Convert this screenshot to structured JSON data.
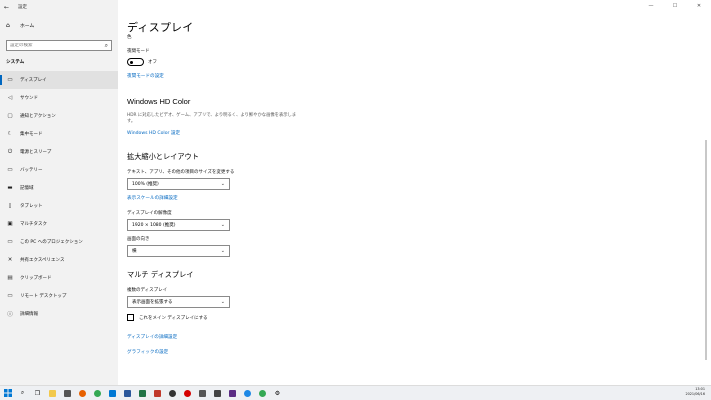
{
  "window": {
    "title": "設定",
    "back_icon": "←",
    "controls": {
      "minimize": "—",
      "maximize": "☐",
      "close": "✕"
    }
  },
  "sidebar": {
    "home_label": "ホーム",
    "search_placeholder": "設定の検索",
    "section_title": "システム",
    "items": [
      {
        "label": "ディスプレイ",
        "icon": "monitor-icon",
        "active": true
      },
      {
        "label": "サウンド",
        "icon": "speaker-icon"
      },
      {
        "label": "通知とアクション",
        "icon": "notification-icon"
      },
      {
        "label": "集中モード",
        "icon": "moon-icon"
      },
      {
        "label": "電源とスリープ",
        "icon": "power-icon"
      },
      {
        "label": "バッテリー",
        "icon": "battery-icon"
      },
      {
        "label": "記憶域",
        "icon": "storage-icon"
      },
      {
        "label": "タブレット",
        "icon": "tablet-icon"
      },
      {
        "label": "マルチタスク",
        "icon": "multitask-icon"
      },
      {
        "label": "この PC へのプロジェクション",
        "icon": "projection-icon"
      },
      {
        "label": "共有エクスペリエンス",
        "icon": "share-icon"
      },
      {
        "label": "クリップボード",
        "icon": "clipboard-icon"
      },
      {
        "label": "リモート デスクトップ",
        "icon": "remote-desktop-icon"
      },
      {
        "label": "詳細情報",
        "icon": "info-icon"
      }
    ]
  },
  "main": {
    "title": "ディスプレイ",
    "color_section": "色",
    "night_light": {
      "label": "夜間モード",
      "state": "オフ",
      "settings_link": "夜間モードの設定"
    },
    "hdr": {
      "heading": "Windows HD Color",
      "description": "HDR に対応したビデオ、ゲーム、アプリで、より明るく、より鮮やかな画像を表示します。",
      "link": "Windows HD Color 設定"
    },
    "scale_layout": {
      "heading": "拡大縮小とレイアウト",
      "scale_label": "テキスト、アプリ、その他の項目のサイズを変更する",
      "scale_value": "100% (推奨)",
      "advanced_scaling_link": "表示スケールの詳細設定",
      "resolution_label": "ディスプレイの解像度",
      "resolution_value": "1920 × 1080 (推奨)",
      "orientation_label": "画面の向き",
      "orientation_value": "横"
    },
    "multi_display": {
      "heading": "マルチ ディスプレイ",
      "label": "複数のディスプレイ",
      "value": "表示画面を拡張する",
      "main_display_checkbox": "これをメイン ディスプレイにする",
      "advanced_display_link": "ディスプレイの詳細設定",
      "graphics_link": "グラフィックの設定"
    }
  },
  "taskbar": {
    "time": "13:01",
    "date": "2021/06/16",
    "apps": [
      {
        "name": "start-icon",
        "color": "#0078d4"
      },
      {
        "name": "search-icon",
        "color": "#222222"
      },
      {
        "name": "task-view-icon",
        "color": "#222222"
      },
      {
        "name": "explorer-icon",
        "color": "#f2c94c"
      },
      {
        "name": "store-icon",
        "color": "#555555"
      },
      {
        "name": "firefox-icon",
        "color": "#e66000"
      },
      {
        "name": "chrome-icon",
        "color": "#34a853"
      },
      {
        "name": "mail-icon",
        "color": "#0078d4"
      },
      {
        "name": "word-icon",
        "color": "#2b579a"
      },
      {
        "name": "excel-icon",
        "color": "#217346"
      },
      {
        "name": "paint-icon",
        "color": "#c0392b"
      },
      {
        "name": "media-icon",
        "color": "#333333"
      },
      {
        "name": "red-app-icon",
        "color": "#d50000"
      },
      {
        "name": "gallery-icon",
        "color": "#555555"
      },
      {
        "name": "terminal-icon",
        "color": "#444444"
      },
      {
        "name": "purple-app-icon",
        "color": "#5b2c83"
      },
      {
        "name": "chat-icon",
        "color": "#1e88e5"
      },
      {
        "name": "browser-icon",
        "color": "#34a853"
      },
      {
        "name": "settings-icon",
        "color": "#333333"
      }
    ]
  },
  "colors": {
    "accent": "#0067c0",
    "sidebar_bg": "#f2f2f2"
  }
}
